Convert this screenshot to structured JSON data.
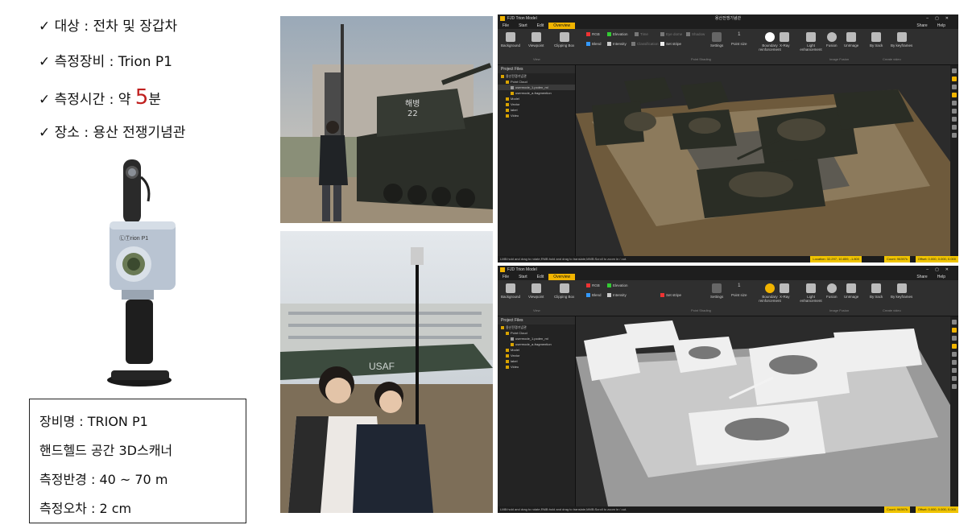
{
  "info": {
    "target": "✓ 대상 : 전차 및 장갑차",
    "equipment": "✓ 측정장비 : Trion P1",
    "time_prefix": "✓ 측정시간 : 약 ",
    "time_value": "5",
    "time_suffix": "분",
    "place": "✓ 장소 : 용산 전쟁기념관"
  },
  "device": {
    "brand": "ⓁⓉrion P1"
  },
  "spec": {
    "name": "장비명 : TRION P1",
    "type": "핸드헬드 공간 3D스캐너",
    "radius": "측정반경 : 40 ~ 70 m",
    "error": "측정오차 : 2 cm"
  },
  "photos": {
    "tank_number_top": "해병",
    "tank_number_bottom": "22",
    "plane_text": "USAF"
  },
  "app": {
    "app_title": "FJD Trion Model",
    "doc_title": "용산전쟁기념관",
    "menu": [
      "File",
      "Start",
      "Edit",
      "Overview"
    ],
    "share": "Share",
    "help": "Help",
    "ribbon": {
      "background": "Background",
      "viewpoint": "Viewpoint",
      "clipping_box": "Clipping Box",
      "rgb": "RGB",
      "elevation": "Elevation",
      "time": "Time",
      "intensity": "Intensity",
      "classification": "Classification",
      "blend": "Blend",
      "set_stripe": "Set stripe",
      "eye_dome": "Eye dome",
      "shadow": "Shadow",
      "settings": "Settings",
      "point_size": "Point size",
      "point_size_value": "1",
      "boundary": "Boundary reinforcement",
      "xray": "X-Ray",
      "light": "Light enhancement",
      "fusion": "Fusion",
      "unimage": "UnImage",
      "by_track": "By track",
      "by_keyframe": "By keyframes",
      "group_view": "View",
      "group_point_shading": "Point Shading",
      "group_image_fusion": "Image Fusion",
      "group_create_video": "Create video"
    },
    "project_files": "Project Files",
    "tree": [
      "용산전쟁기념관",
      "Point Cloud",
      "usermode_1.pcden_ml",
      "usermode_a-fragmention",
      "Model",
      "Vector",
      "label",
      "Video"
    ],
    "status_msg": "LMB:hold and drag to rotate,RMB:hold and drag to translate,MMB:Scroll to zoom in / out.",
    "status_location": "Location: 32.297, 10.859, -1.800",
    "status_count": "Count: 96397k",
    "status_offset": "Offset: 0.000, 0.000, 0.000",
    "status_count2": "Count: 96397k"
  },
  "colors": {
    "accent": "#f1b400",
    "red": "#c0201f"
  }
}
